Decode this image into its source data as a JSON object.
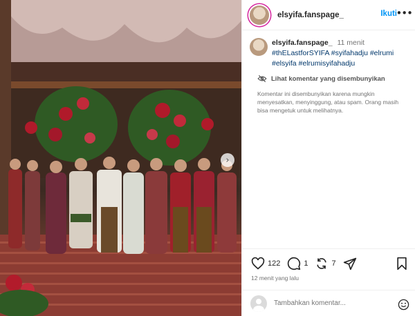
{
  "post": {
    "username": "elsyifa.fanspage_",
    "follow_label": "Ikuti",
    "more_label": "•••"
  },
  "caption": {
    "username": "elsyifa.fanspage_",
    "time": "11 menit",
    "hashtags": "#thELastforSYIFA #syifahadju #elrumi #elsyifa #elrumisyifahadju"
  },
  "hidden_comments": {
    "toggle_label": "Lihat komentar yang disembunyikan",
    "note": "Komentar ini disembunyikan karena mungkin menyesatkan, menyinggung, atau spam. Orang masih bisa mengetuk untuk melihatnya."
  },
  "actions": {
    "likes": "122",
    "comments": "1",
    "reposts": "7"
  },
  "timestamp": "12 menit yang lalu",
  "comment_input": {
    "placeholder": "Tambahkan komentar..."
  },
  "icons": {
    "like": "heart-icon",
    "comment": "comment-icon",
    "repost": "repost-icon",
    "share": "share-icon",
    "save": "bookmark-icon",
    "emoji": "emoji-icon",
    "hidden": "eye-slash-icon",
    "next": "chevron-right-icon"
  },
  "colors": {
    "accent": "#0095f6",
    "hashtag": "#00376b",
    "muted": "#737373"
  }
}
